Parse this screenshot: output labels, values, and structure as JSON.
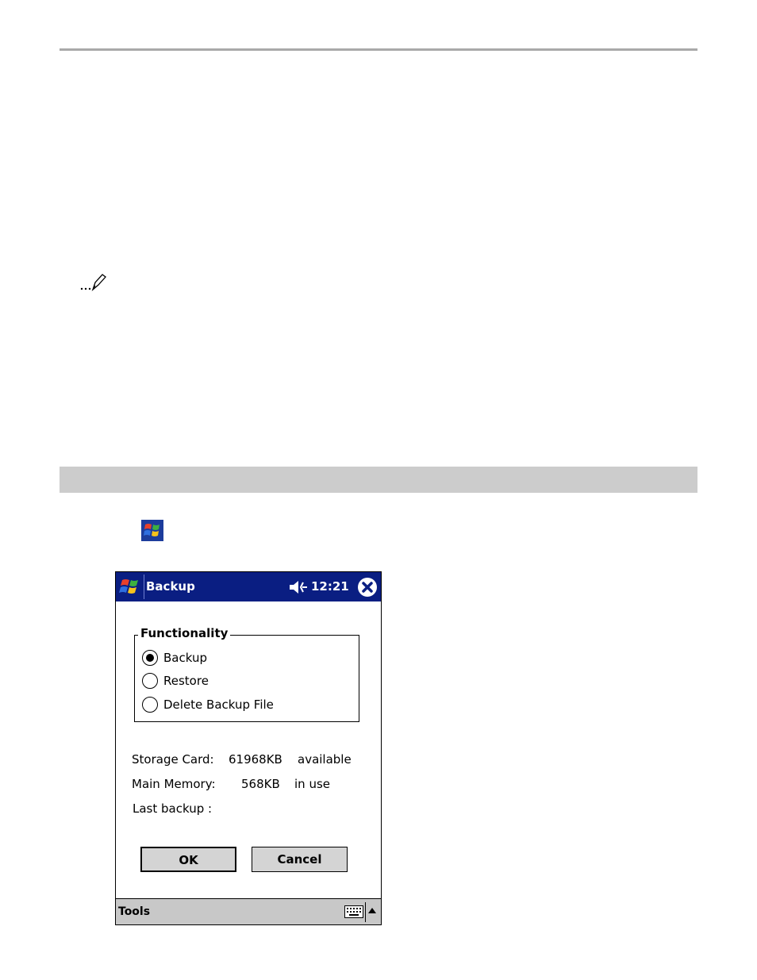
{
  "window": {
    "title": "Backup",
    "time": "12:21"
  },
  "functionality": {
    "legend": "Functionality",
    "options": [
      {
        "label": "Backup",
        "selected": true
      },
      {
        "label": "Restore",
        "selected": false
      },
      {
        "label": "Delete Backup File",
        "selected": false
      }
    ]
  },
  "info": {
    "storage_label": "Storage Card:",
    "storage_value": "61968KB",
    "storage_status": "available",
    "memory_label": "Main Memory:",
    "memory_value": "568KB",
    "memory_status": "in use",
    "last_backup_label": "Last backup :"
  },
  "buttons": {
    "ok": "OK",
    "cancel": "Cancel"
  },
  "menubar": {
    "tools": "Tools"
  },
  "icons": [
    "note-pencil-icon",
    "windows-flag-icon",
    "speaker-icon",
    "close-icon",
    "keyboard-icon",
    "arrow-up-icon"
  ],
  "colors": {
    "titlebar": "#0a1e82",
    "section_bar": "#cccccc",
    "button_face": "#d4d4d4",
    "menubar": "#c8c8c8"
  }
}
